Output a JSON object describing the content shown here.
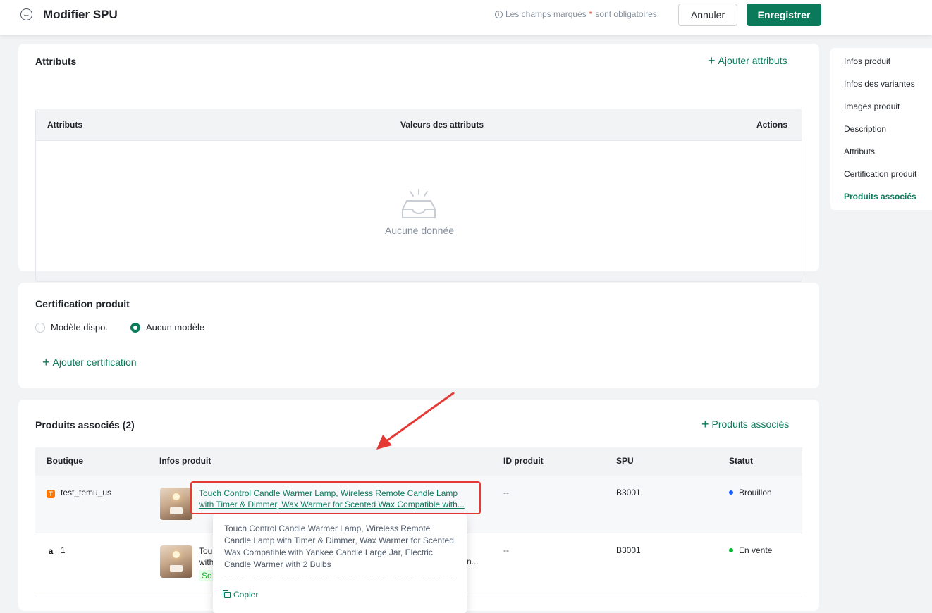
{
  "header": {
    "back_icon": "arrow-left-icon",
    "title": "Modifier SPU",
    "hint_prefix": "Les champs marqués",
    "hint_star": "*",
    "hint_suffix": "sont obligatoires.",
    "cancel_label": "Annuler",
    "save_label": "Enregistrer",
    "accent": "#0a7a5a"
  },
  "attributes": {
    "title": "Attributs",
    "add_label": "Ajouter attributs",
    "columns": [
      "Attributs",
      "Valeurs des attributs",
      "Actions"
    ],
    "empty_text": "Aucune donnée"
  },
  "certification": {
    "title": "Certification produit",
    "options": [
      {
        "label": "Modèle dispo.",
        "selected": false
      },
      {
        "label": "Aucun modèle",
        "selected": true
      }
    ],
    "add_label": "Ajouter certification"
  },
  "associated": {
    "title": "Produits associés (2)",
    "add_label": "Produits associés",
    "columns": [
      "Boutique",
      "Infos produit",
      "ID produit",
      "SPU",
      "Statut"
    ],
    "rows": [
      {
        "shop_icon": "temu-icon",
        "shop": "test_temu_us",
        "product_line1": "Touch Control Candle Warmer Lamp, Wireless Remote Candle Lamp",
        "product_line2": "with Timer & Dimmer, Wax Warmer for Scented Wax Compatible with...",
        "product_id": "--",
        "spu": "B3001",
        "status": "Brouillon",
        "status_color": "#165dff"
      },
      {
        "shop_icon": "amazon-icon",
        "shop": "1",
        "product_line1": "Tou",
        "product_line2": "with",
        "product_tail": "n...",
        "badge": "So",
        "product_id": "--",
        "spu": "B3001",
        "status": "En vente",
        "status_color": "#00b42a"
      }
    ]
  },
  "tooltip": {
    "text": "Touch Control Candle Warmer Lamp, Wireless Remote Candle Lamp with Timer & Dimmer, Wax Warmer for Scented Wax Compatible with Yankee Candle Large Jar, Electric Candle Warmer with 2 Bulbs",
    "copy_label": "Copier"
  },
  "anchor_nav": {
    "items": [
      "Infos produit",
      "Infos des variantes",
      "Images produit",
      "Description",
      "Attributs",
      "Certification produit",
      "Produits associés"
    ],
    "active_index": 6
  },
  "annotation": {
    "highlight_color": "#e53935"
  }
}
